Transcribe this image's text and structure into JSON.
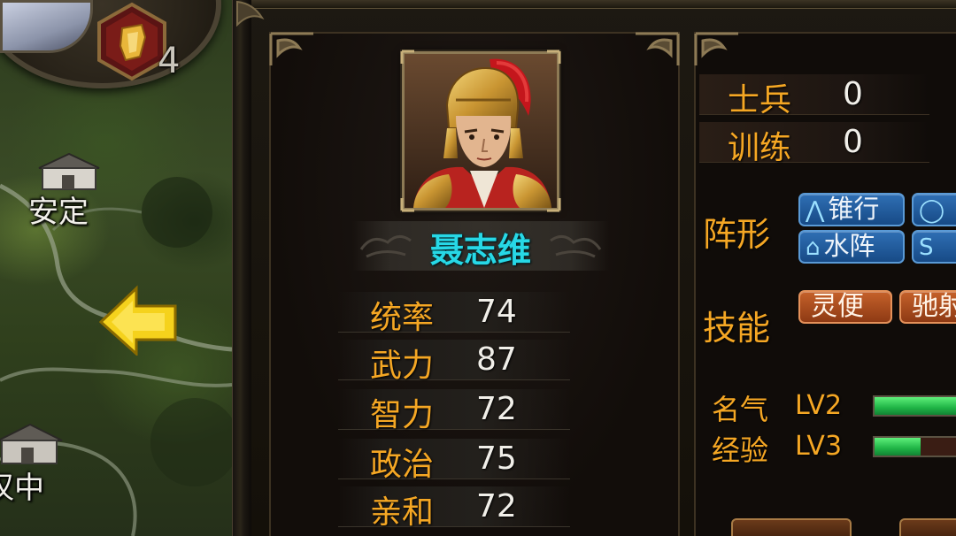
{
  "map": {
    "badge_count": "4",
    "cities": [
      {
        "name": "安定"
      },
      {
        "name": "汉中"
      }
    ]
  },
  "hero": {
    "name": "聂志维",
    "stats": [
      {
        "label": "统率",
        "value": "74"
      },
      {
        "label": "武力",
        "value": "87"
      },
      {
        "label": "智力",
        "value": "72"
      },
      {
        "label": "政治",
        "value": "75"
      },
      {
        "label": "亲和",
        "value": "72"
      }
    ]
  },
  "troops": [
    {
      "label": "士兵",
      "value": "0"
    },
    {
      "label": "训练",
      "value": "0"
    }
  ],
  "formation": {
    "label": "阵形",
    "tags": [
      {
        "icon": "⋀",
        "text": "锥行"
      },
      {
        "icon": "◯",
        "text": ""
      },
      {
        "icon": "⌂",
        "text": "水阵"
      },
      {
        "icon": "S",
        "text": ""
      }
    ]
  },
  "skills": {
    "label": "技能",
    "tags": [
      "灵便",
      "驰射"
    ]
  },
  "levels": [
    {
      "label": "名气",
      "level": "LV2",
      "progress": 1.0
    },
    {
      "label": "经验",
      "level": "LV3",
      "progress": 0.45
    }
  ],
  "colors": {
    "name": "#27d8e6",
    "label_gold": "#f5a724",
    "value_white": "#f1efe9",
    "formation_blue": "#2f6fb4",
    "skill_orange": "#c5612a"
  }
}
